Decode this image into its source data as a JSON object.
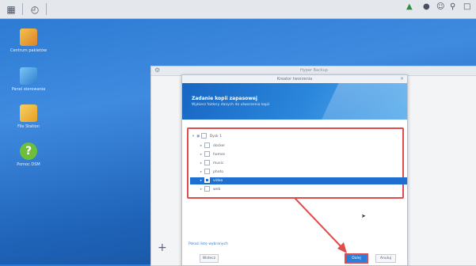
{
  "taskbar": {
    "left_icons": [
      "grid-icon",
      "clock-icon"
    ],
    "right_icons": [
      "sync-icon",
      "notification-icon",
      "user-icon",
      "search-icon",
      "widgets-icon"
    ]
  },
  "desktop_icons": [
    {
      "label": "Centrum pakietów",
      "icon": "package-center-icon",
      "color": "#e0a12b"
    },
    {
      "label": "Panel sterowania",
      "icon": "control-panel-icon",
      "color": "#3aa0e8"
    },
    {
      "label": "File Station",
      "icon": "folder-icon",
      "color": "#f1b62e"
    },
    {
      "label": "Pomoc DSM",
      "icon": "help-icon",
      "color": "#6bbf3a"
    }
  ],
  "bg_window": {
    "title": "Hyper Backup"
  },
  "modal": {
    "title": "Kreator tworzenia",
    "banner_title": "Zadanie kopii zapasowej",
    "banner_subtitle": "Wybierz foldery danych do utworzenia kopii",
    "tree": [
      {
        "label": "Dysk 1",
        "level": 0,
        "checked": false,
        "selected": false,
        "expanded": true
      },
      {
        "label": "docker",
        "level": 1,
        "checked": false,
        "selected": false
      },
      {
        "label": "homes",
        "level": 1,
        "checked": false,
        "selected": false
      },
      {
        "label": "music",
        "level": 1,
        "checked": false,
        "selected": false
      },
      {
        "label": "photo",
        "level": 1,
        "checked": false,
        "selected": false
      },
      {
        "label": "video",
        "level": 1,
        "checked": true,
        "selected": true
      },
      {
        "label": "web",
        "level": 1,
        "checked": false,
        "selected": false
      }
    ],
    "footer_link": "Pokaż listę wybranych",
    "buttons": {
      "back": "Wstecz",
      "next": "Dalej",
      "cancel": "Anuluj"
    }
  },
  "colors": {
    "accent": "#2b7dd9",
    "highlight": "#e04b4b"
  }
}
